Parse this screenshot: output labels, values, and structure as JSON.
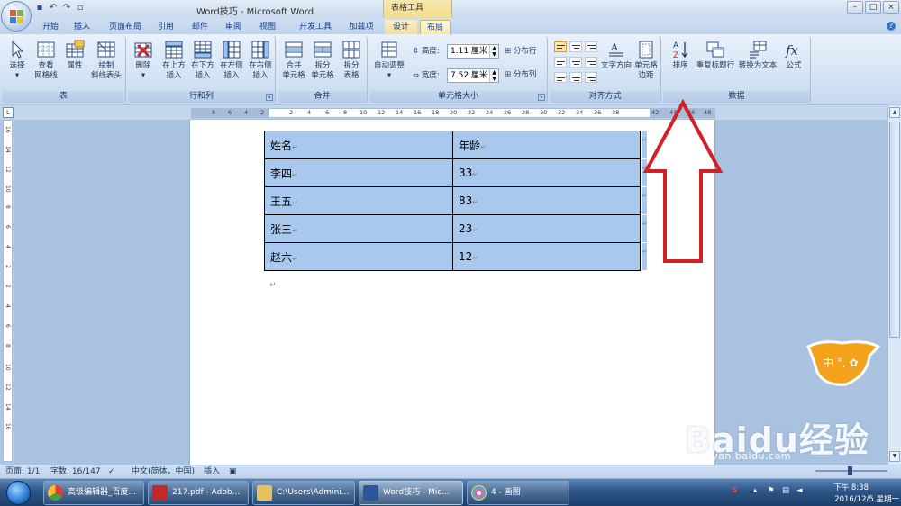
{
  "window": {
    "title": "Word技巧 - Microsoft Word",
    "context_caption": "表格工具",
    "controls": [
      "–",
      "□",
      "×"
    ]
  },
  "qat": [
    "save-icon",
    "undo-icon",
    "redo-icon",
    "quickprint-icon"
  ],
  "tabs": {
    "home": "开始",
    "insert": "插入",
    "pagelayout": "页面布局",
    "references": "引用",
    "mailings": "邮件",
    "review": "审阅",
    "view": "视图",
    "developer": "开发工具",
    "addins": "加载项",
    "design": "设计",
    "layout": "布局"
  },
  "ribbon": {
    "table": {
      "label": "表",
      "select": "选择",
      "gridlines_1": "查看",
      "gridlines_2": "网格线",
      "properties": "属性",
      "draw_1": "绘制",
      "draw_2": "斜线表头"
    },
    "rows_cols": {
      "label": "行和列",
      "delete": "删除",
      "above_1": "在上方",
      "above_2": "插入",
      "below_1": "在下方",
      "below_2": "插入",
      "left_1": "在左侧",
      "left_2": "插入",
      "right_1": "在右侧",
      "right_2": "插入"
    },
    "merge": {
      "label": "合并",
      "merge_1": "合并",
      "merge_2": "单元格",
      "split_1": "拆分",
      "split_2": "单元格",
      "splittable_1": "拆分",
      "splittable_2": "表格"
    },
    "cellsize": {
      "label": "单元格大小",
      "autofit": "自动调整",
      "height_label": "高度:",
      "height_value": "1.11 厘米",
      "width_label": "宽度:",
      "width_value": "7.52 厘米",
      "dist_rows": "分布行",
      "dist_cols": "分布列"
    },
    "alignment": {
      "label": "对齐方式",
      "text_direction": "文字方向",
      "margins_1": "单元格",
      "margins_2": "边距"
    },
    "data": {
      "label": "数据",
      "sort": "排序",
      "repeat_header": "重复标题行",
      "convert_text": "转换为文本",
      "formula": "公式"
    }
  },
  "ruler": {
    "h_left": [
      "8",
      "6",
      "4",
      "2"
    ],
    "h_right": [
      "2",
      "4",
      "6",
      "8",
      "10",
      "12",
      "14",
      "16",
      "18",
      "20",
      "22",
      "24",
      "26",
      "28",
      "30",
      "32",
      "34",
      "36",
      "38",
      "42",
      "44",
      "46",
      "48"
    ],
    "v": [
      "16",
      "14",
      "12",
      "10",
      "8",
      "6",
      "4",
      "2",
      "2",
      "4",
      "6",
      "8",
      "10",
      "12",
      "14",
      "16"
    ]
  },
  "document": {
    "table": {
      "rows": [
        [
          "姓名",
          "年龄"
        ],
        [
          "李四",
          "33"
        ],
        [
          "王五",
          "83"
        ],
        [
          "张三",
          "23"
        ],
        [
          "赵六",
          "12"
        ]
      ],
      "cell_mark": "↵"
    },
    "para_mark": "↵"
  },
  "ime": {
    "text": "中 °, ✿"
  },
  "watermark": {
    "brand": "Baidu经验",
    "url": "jingyan.baidu.com"
  },
  "statusbar": {
    "page": "页面: 1/1",
    "words": "字数: 16/147",
    "language": "中文(简体，中国)",
    "mode": "插入"
  },
  "taskbar": {
    "items": [
      "高级编辑器_百度...",
      "217.pdf - Adob...",
      "C:\\Users\\Admini...",
      "Word技巧 - Mic...",
      "4 - 画图"
    ],
    "time": "下午 8:38",
    "date": "2016/12/5 星期一"
  },
  "colors": {
    "table_highlight": "#a9c8ee",
    "arrow": "#d32027",
    "active_tab": "#f8e6a8"
  }
}
